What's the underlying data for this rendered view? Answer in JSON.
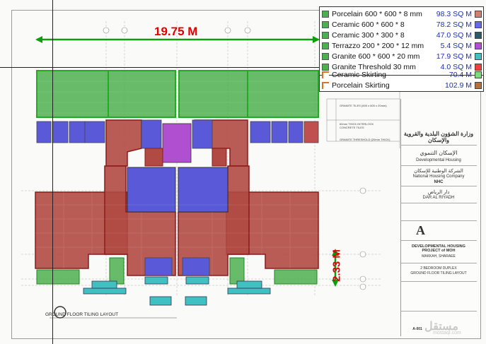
{
  "dimension_horizontal": "19.75 M",
  "dimension_vertical": "2.33 M",
  "legend": {
    "items": [
      {
        "name": "Porcelain 600 * 600 * 8 mm",
        "value": "98.3 SQ M",
        "color": "#d08070",
        "icon_color": "#4caf50"
      },
      {
        "name": "Ceramic 600 * 600 * 8",
        "value": "78.2 SQ M",
        "color": "#6666ee",
        "icon_color": "#4caf50"
      },
      {
        "name": "Ceramic 300 * 300 * 8",
        "value": "47.0 SQ M",
        "color": "#2c5a6a",
        "icon_color": "#4caf50"
      },
      {
        "name": "Terrazzo 200 * 200 * 12 mm",
        "value": "5.4 SQ M",
        "color": "#b050d0",
        "icon_color": "#4caf50"
      },
      {
        "name": "Granite 600 * 600 * 20 mm",
        "value": "17.9 SQ M",
        "color": "#40c0c0",
        "icon_color": "#4caf50"
      },
      {
        "name": "Granite Threshold 30 mm",
        "value": "4.0 SQ M",
        "color": "#ee4040",
        "icon_color": "#4caf50"
      },
      {
        "name": "Ceramic Skirting",
        "value": "70.4 M",
        "color": "#7cdc7c",
        "icon_color": "#e07020"
      },
      {
        "name": "Porcelain Skirting",
        "value": "102.9 M",
        "color": "#b07040",
        "icon_color": "#e07020"
      }
    ]
  },
  "tile_notes": [
    "GRANITE TILES (600 x 600 x 20mm)",
    "60mm THICK INTERLOCK CONCRETE TILES",
    "GRANITE THRESHOLD (20mm THICK)"
  ],
  "title_block": {
    "ministry_ar": "وزارة الشؤون البلدية والقروية والإسكان",
    "developmental_housing_ar": "الإسكان التنموي",
    "developmental_housing_en": "Developmental Housing",
    "nhc_ar": "الشركة الوطنية للإسكان",
    "nhc_en": "National Housing Company",
    "nhc_abbr": "NHC",
    "dar_ar": "دار الرياض",
    "dar_en": "DAR AL RIYADH",
    "project_title": "DEVELOPMENTAL HOUSING PROJECT of MOH",
    "project_location": "MAKKAH, SHARAEE",
    "sheet_title_1": "2 BEDROOM DUPLEX",
    "sheet_title_2": "GROUND FLOOR TILING LAYOUT",
    "sheet_no": "A-001"
  },
  "drawing_title": "GROUND FLOOR TILING LAYOUT",
  "watermark": "مستقل",
  "watermark_url": "mostaql.com"
}
